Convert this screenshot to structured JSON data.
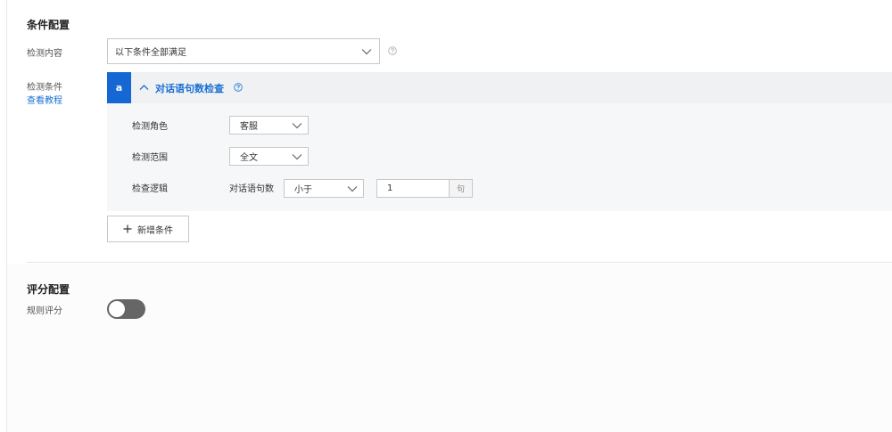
{
  "condition_config": {
    "title": "条件配置",
    "detect_content_label": "检测内容",
    "detect_content_value": "以下条件全部满足",
    "detect_conditions_label": "检测条件",
    "tutorial_link": "查看教程",
    "conditions": [
      {
        "letter": "a",
        "title": "对话语句数检查",
        "role_label": "检测角色",
        "role_value": "客服",
        "range_label": "检测范围",
        "range_value": "全文",
        "logic_label": "检查逻辑",
        "logic_prefix": "对话语句数",
        "logic_operator": "小于",
        "logic_number": "1",
        "logic_unit": "句"
      }
    ],
    "add_condition_label": "新增条件"
  },
  "score_config": {
    "title": "评分配置",
    "rule_score_label": "规则评分",
    "rule_score_enabled": false
  },
  "colors": {
    "accent": "#1567d3",
    "link": "#1a6fd4",
    "toggle_off": "#666666"
  }
}
